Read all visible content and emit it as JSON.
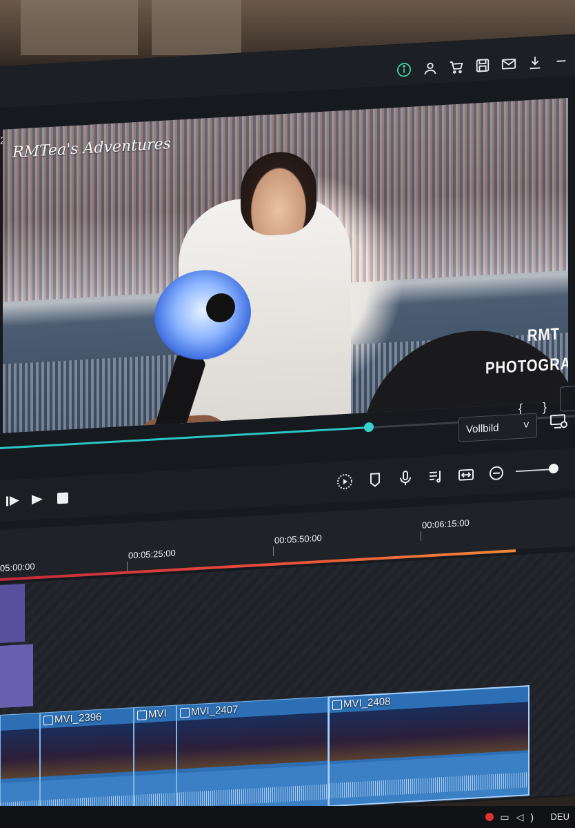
{
  "window": {
    "edge_number": "2"
  },
  "topbar": {
    "icons": [
      "info-icon",
      "user-icon",
      "cart-icon",
      "save-icon",
      "mail-icon",
      "download-icon",
      "minimize-icon"
    ]
  },
  "preview": {
    "watermark_top": "RMTea's Adventures",
    "watermark_right_line1": "RMT",
    "watermark_right_line2": "PHOTOGRAPHS",
    "braces": "{ }",
    "playhead_fraction": 0.63
  },
  "view": {
    "mode_label": "Vollbild",
    "chevron": "˅"
  },
  "timeline": {
    "ruler": [
      "05:00:00",
      "00:05:25:00",
      "00:05:50:00",
      "00:06:15:00"
    ],
    "clips": [
      {
        "label": ""
      },
      {
        "label": "MVI_2396"
      },
      {
        "label": "MVI"
      },
      {
        "label": "MVI_2407"
      },
      {
        "label": "MVI_2408"
      }
    ]
  },
  "taskbar": {
    "language": "DEU"
  },
  "colors": {
    "accent_teal": "#2cc7c4",
    "clip_blue": "#2d6fb4",
    "info_green": "#3fd19a"
  }
}
